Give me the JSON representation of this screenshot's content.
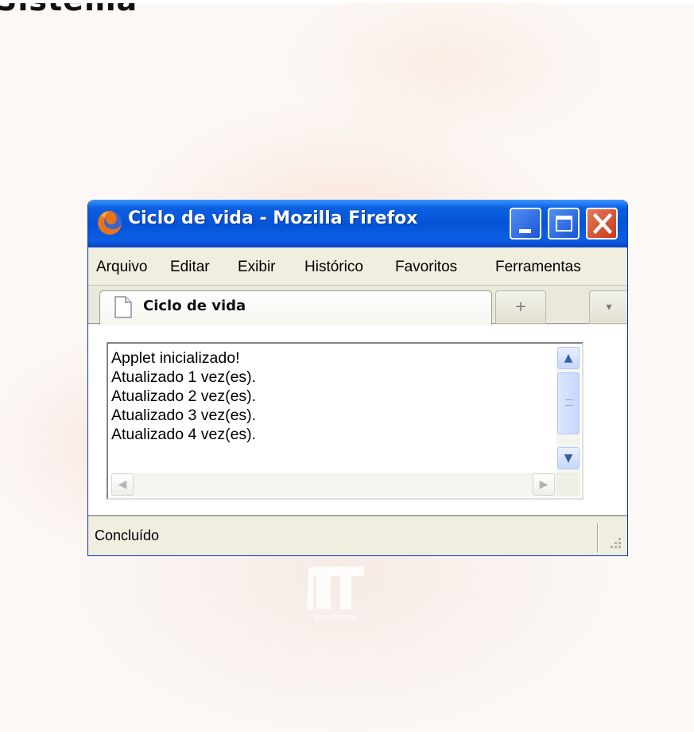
{
  "background": {
    "corner_text": "Sistema",
    "watermark_text": "NOVATERRA"
  },
  "window": {
    "title": "Ciclo de vida - Mozilla Firefox",
    "title_bar_color": "#0554d8",
    "close_button_color": "#c8391a"
  },
  "menubar": {
    "items": [
      {
        "label": "Arquivo"
      },
      {
        "label": "Editar"
      },
      {
        "label": "Exibir"
      },
      {
        "label": "Histórico"
      },
      {
        "label": "Favoritos"
      },
      {
        "label": "Ferramentas"
      }
    ]
  },
  "tabs": {
    "active_label": "Ciclo de vida",
    "new_tab_glyph": "+",
    "list_tabs_glyph": "▾"
  },
  "applet": {
    "lines": [
      "Applet inicializado!",
      "Atualizado 1 vez(es).",
      "Atualizado 2 vez(es).",
      "Atualizado 3 vez(es).",
      "Atualizado 4 vez(es)."
    ],
    "scroll_up_glyph": "▲",
    "scroll_down_glyph": "▼",
    "scroll_left_glyph": "◀",
    "scroll_right_glyph": "▶"
  },
  "statusbar": {
    "text": "Concluído"
  }
}
